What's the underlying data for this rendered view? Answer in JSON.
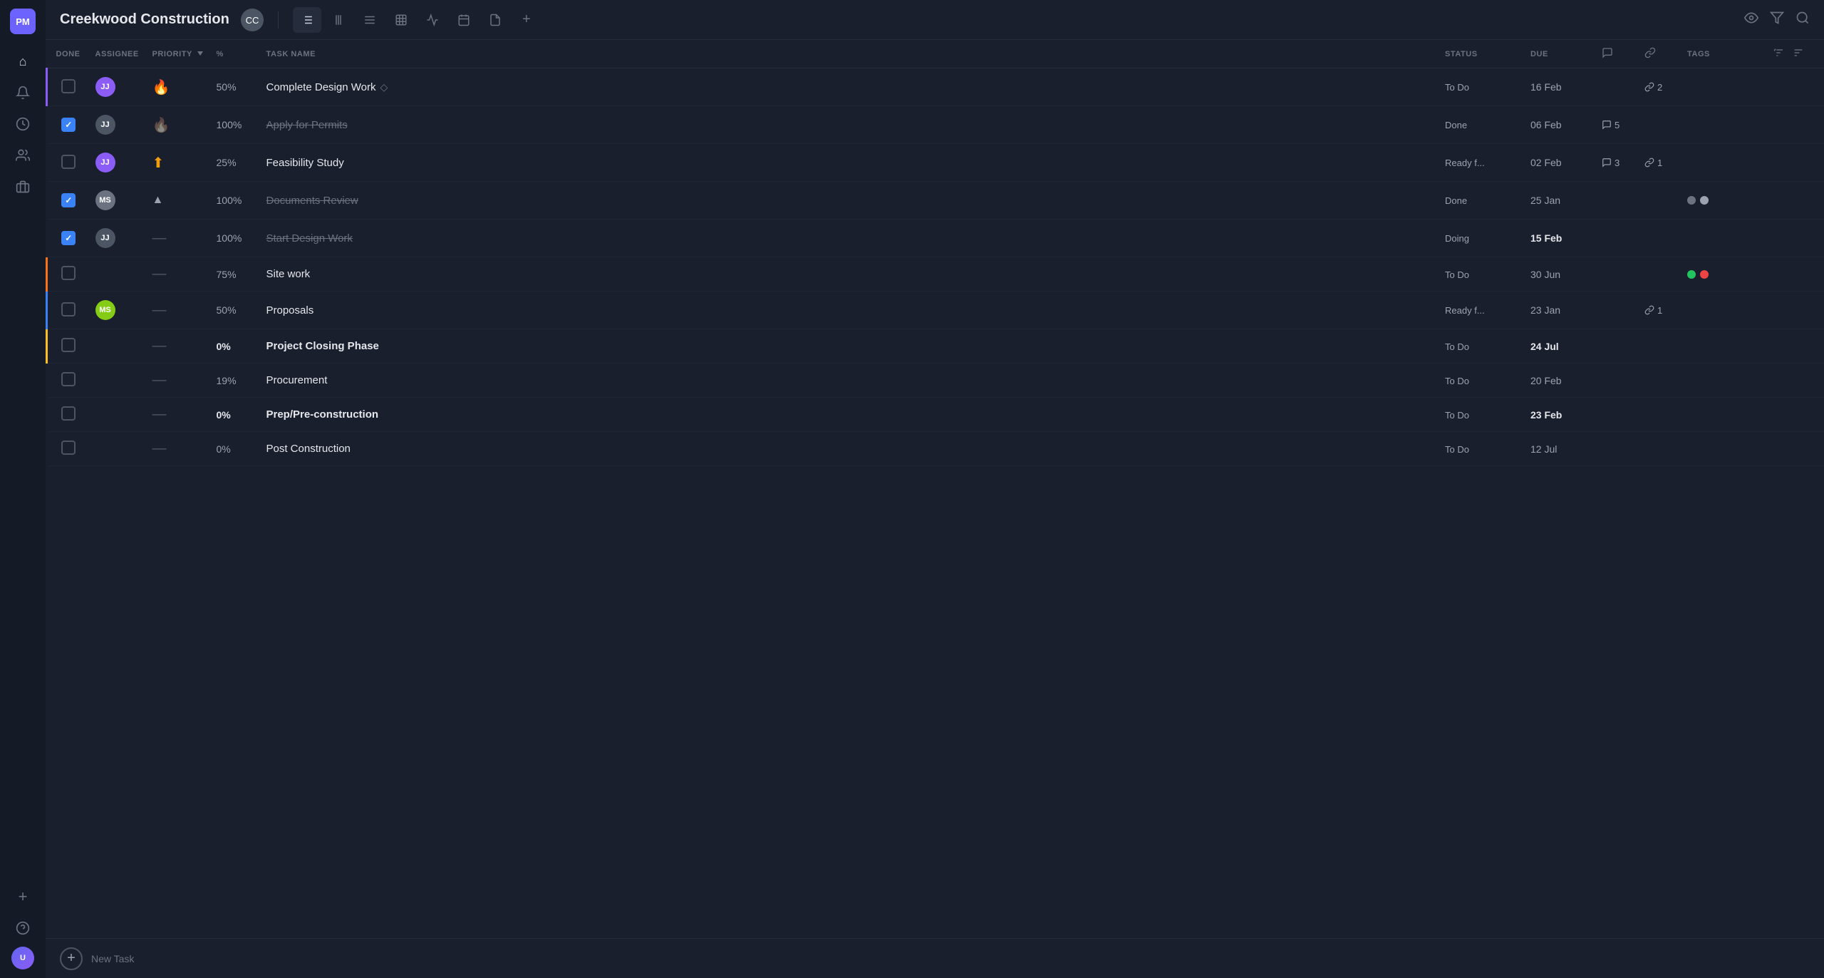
{
  "app": {
    "title": "Creekwood Construction"
  },
  "sidebar": {
    "logo": "PM",
    "icons": [
      {
        "name": "home-icon",
        "glyph": "⌂"
      },
      {
        "name": "notification-icon",
        "glyph": "🔔"
      },
      {
        "name": "clock-icon",
        "glyph": "🕐"
      },
      {
        "name": "people-icon",
        "glyph": "👥"
      },
      {
        "name": "briefcase-icon",
        "glyph": "💼"
      }
    ],
    "bottom_icons": [
      {
        "name": "plus-icon",
        "glyph": "+"
      },
      {
        "name": "help-icon",
        "glyph": "?"
      }
    ]
  },
  "topbar": {
    "title": "Creekwood Construction",
    "view_tabs": [
      {
        "name": "list-view-tab",
        "glyph": "≡",
        "active": true
      },
      {
        "name": "gantt-view-tab",
        "glyph": "⫼",
        "active": false
      },
      {
        "name": "board-view-tab",
        "glyph": "≡",
        "active": false
      },
      {
        "name": "table-view-tab",
        "glyph": "⊞",
        "active": false
      },
      {
        "name": "chart-view-tab",
        "glyph": "∿",
        "active": false
      },
      {
        "name": "calendar-view-tab",
        "glyph": "⬛",
        "active": false
      },
      {
        "name": "doc-view-tab",
        "glyph": "📄",
        "active": false
      },
      {
        "name": "add-view-tab",
        "glyph": "+",
        "active": false
      }
    ],
    "actions": [
      {
        "name": "watch-icon",
        "glyph": "👁"
      },
      {
        "name": "filter-icon",
        "glyph": "⧩"
      },
      {
        "name": "search-icon",
        "glyph": "🔍"
      }
    ]
  },
  "table": {
    "columns": {
      "done": "DONE",
      "assignee": "ASSIGNEE",
      "priority": "PRIORITY",
      "percent": "%",
      "task_name": "TASK NAME",
      "status": "STATUS",
      "due": "DUE",
      "comments": "💬",
      "links": "🔗",
      "tags": "TAGS"
    },
    "rows": [
      {
        "id": "row-1",
        "done": false,
        "assignee": {
          "initials": "JJ",
          "color": "#8b5cf6"
        },
        "priority": {
          "type": "fire",
          "glyph": "🔥"
        },
        "percent": "50%",
        "percent_bold": false,
        "task_name": "Complete Design Work",
        "task_name_suffix": "◇",
        "task_strikethrough": false,
        "task_bold": false,
        "status": "To Do",
        "due": "16 Feb",
        "due_bold": false,
        "comments": null,
        "links": "2",
        "tags": [],
        "row_border": "purple"
      },
      {
        "id": "row-2",
        "done": true,
        "assignee": {
          "initials": "JJ",
          "color": "#4b5563"
        },
        "priority": {
          "type": "flame-low",
          "glyph": "🔥"
        },
        "percent": "100%",
        "percent_bold": false,
        "task_name": "Apply for Permits",
        "task_name_suffix": "",
        "task_strikethrough": true,
        "task_bold": false,
        "status": "Done",
        "due": "06 Feb",
        "due_bold": false,
        "comments": "5",
        "links": null,
        "tags": [],
        "row_border": "none"
      },
      {
        "id": "row-3",
        "done": false,
        "assignee": {
          "initials": "JJ",
          "color": "#8b5cf6"
        },
        "priority": {
          "type": "arrow-up",
          "glyph": "⬆"
        },
        "percent": "25%",
        "percent_bold": false,
        "task_name": "Feasibility Study",
        "task_name_suffix": "",
        "task_strikethrough": false,
        "task_bold": false,
        "status": "Ready f...",
        "due": "02 Feb",
        "due_bold": false,
        "comments": "3",
        "links": "1",
        "tags": [],
        "row_border": "none"
      },
      {
        "id": "row-4",
        "done": true,
        "assignee": {
          "initials": "MS",
          "color": "#6b7280"
        },
        "priority": {
          "type": "medium",
          "glyph": "▲"
        },
        "percent": "100%",
        "percent_bold": false,
        "task_name": "Documents Review",
        "task_name_suffix": "",
        "task_strikethrough": true,
        "task_bold": false,
        "status": "Done",
        "due": "25 Jan",
        "due_bold": false,
        "comments": null,
        "links": null,
        "tags": [
          "gray",
          "gray-light"
        ],
        "row_border": "none"
      },
      {
        "id": "row-5",
        "done": true,
        "assignee": {
          "initials": "JJ",
          "color": "#4b5563"
        },
        "priority": {
          "type": "dash",
          "glyph": "—"
        },
        "percent": "100%",
        "percent_bold": false,
        "task_name": "Start Design Work",
        "task_name_suffix": "",
        "task_strikethrough": true,
        "task_bold": false,
        "status": "Doing",
        "due": "15 Feb",
        "due_bold": true,
        "comments": null,
        "links": null,
        "tags": [],
        "row_border": "none"
      },
      {
        "id": "row-6",
        "done": false,
        "assignee": null,
        "priority": {
          "type": "dash",
          "glyph": "—"
        },
        "percent": "75%",
        "percent_bold": false,
        "task_name": "Site work",
        "task_name_suffix": "",
        "task_strikethrough": false,
        "task_bold": false,
        "status": "To Do",
        "due": "30 Jun",
        "due_bold": false,
        "comments": null,
        "links": null,
        "tags": [
          "green",
          "red"
        ],
        "row_border": "orange"
      },
      {
        "id": "row-7",
        "done": false,
        "assignee": {
          "initials": "MS",
          "color": "#84cc16"
        },
        "priority": {
          "type": "dash",
          "glyph": "—"
        },
        "percent": "50%",
        "percent_bold": false,
        "task_name": "Proposals",
        "task_name_suffix": "",
        "task_strikethrough": false,
        "task_bold": false,
        "status": "Ready f...",
        "due": "23 Jan",
        "due_bold": false,
        "comments": null,
        "links": "1",
        "tags": [],
        "row_border": "blue"
      },
      {
        "id": "row-8",
        "done": false,
        "assignee": null,
        "priority": {
          "type": "dash",
          "glyph": "—"
        },
        "percent": "0%",
        "percent_bold": true,
        "task_name": "Project Closing Phase",
        "task_name_suffix": "",
        "task_strikethrough": false,
        "task_bold": true,
        "status": "To Do",
        "due": "24 Jul",
        "due_bold": true,
        "comments": null,
        "links": null,
        "tags": [],
        "row_border": "yellow"
      },
      {
        "id": "row-9",
        "done": false,
        "assignee": null,
        "priority": {
          "type": "dash",
          "glyph": "—"
        },
        "percent": "19%",
        "percent_bold": false,
        "task_name": "Procurement",
        "task_name_suffix": "",
        "task_strikethrough": false,
        "task_bold": false,
        "status": "To Do",
        "due": "20 Feb",
        "due_bold": false,
        "comments": null,
        "links": null,
        "tags": [],
        "row_border": "none"
      },
      {
        "id": "row-10",
        "done": false,
        "assignee": null,
        "priority": {
          "type": "dash",
          "glyph": "—"
        },
        "percent": "0%",
        "percent_bold": true,
        "task_name": "Prep/Pre-construction",
        "task_name_suffix": "",
        "task_strikethrough": false,
        "task_bold": true,
        "status": "To Do",
        "due": "23 Feb",
        "due_bold": true,
        "comments": null,
        "links": null,
        "tags": [],
        "row_border": "none"
      },
      {
        "id": "row-11",
        "done": false,
        "assignee": null,
        "priority": {
          "type": "dash",
          "glyph": "—"
        },
        "percent": "0%",
        "percent_bold": false,
        "task_name": "Post Construction",
        "task_name_suffix": "",
        "task_strikethrough": false,
        "task_bold": false,
        "status": "To Do",
        "due": "12 Jul",
        "due_bold": false,
        "comments": null,
        "links": null,
        "tags": [],
        "row_border": "none"
      }
    ]
  },
  "bottombar": {
    "add_label": "New Task",
    "add_icon": "+"
  }
}
